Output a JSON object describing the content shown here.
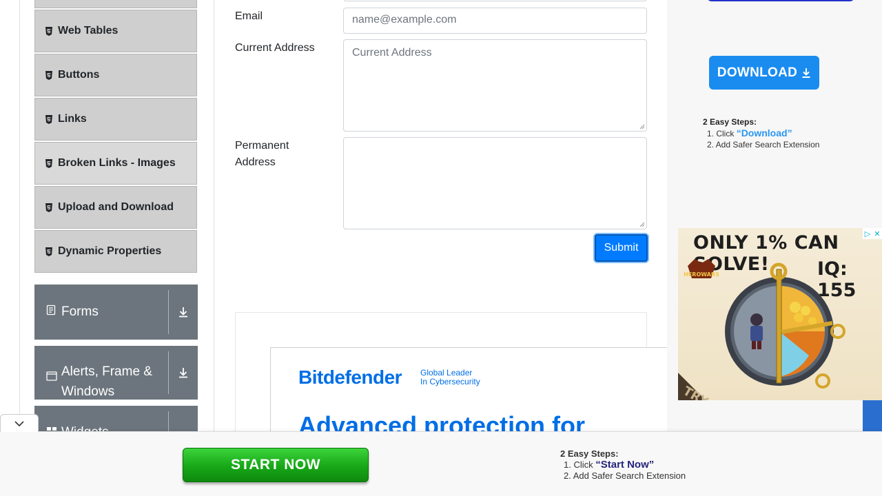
{
  "sidebar": {
    "items": [
      {
        "label": "Web Tables"
      },
      {
        "label": "Buttons"
      },
      {
        "label": "Links"
      },
      {
        "label": "Broken Links - Images"
      },
      {
        "label": "Upload and Download"
      },
      {
        "label": "Dynamic Properties"
      }
    ],
    "groups": [
      {
        "label": "Forms"
      },
      {
        "label": "Alerts, Frame & Windows"
      },
      {
        "label": "Widgets"
      }
    ]
  },
  "form": {
    "email_label": "Email",
    "email_placeholder": "name@example.com",
    "current_address_label": "Current Address",
    "current_address_placeholder": "Current Address",
    "permanent_address_label": "Permanent Address",
    "submit_label": "Submit"
  },
  "ads": {
    "bitdefender": {
      "logo": "Bitdefender",
      "tagline_line1": "Global Leader",
      "tagline_line2": "In Cybersecurity",
      "headline": "Advanced protection for"
    },
    "side": {
      "download_label": "DOWNLOAD",
      "steps_title": "2 Easy Steps:",
      "step1_prefix": "1. Click ",
      "step1_highlight": "“Download”",
      "step2": "2. Add Safer Search Extension"
    },
    "game": {
      "title": "ONLY 1% CAN SOLVE!",
      "iq": "IQ: 155",
      "brand": "HERO WARS",
      "corner": "TRY"
    },
    "bottom": {
      "start_label": "START NOW",
      "steps_title": "2 Easy Steps:",
      "step1_prefix": "1. Click ",
      "step1_highlight": "“Start Now”",
      "step2": "2. Add Safer Search Extension"
    }
  },
  "colors": {
    "primary": "#007bff",
    "menu_bg": "#cfcfcf",
    "group_bg": "#6c757d",
    "start_green": "#17a717",
    "download_blue": "#1a8cf0"
  }
}
